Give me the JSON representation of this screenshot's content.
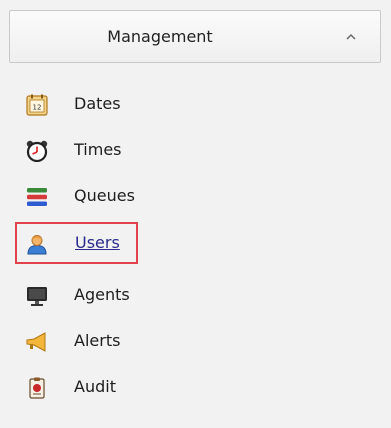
{
  "header": {
    "title": "Management"
  },
  "menu": {
    "items": [
      {
        "label": "Dates",
        "icon": "calendar-icon"
      },
      {
        "label": "Times",
        "icon": "alarm-clock-icon"
      },
      {
        "label": "Queues",
        "icon": "queues-icon"
      },
      {
        "label": "Users",
        "icon": "user-icon",
        "selected": true
      },
      {
        "label": "Agents",
        "icon": "monitor-icon"
      },
      {
        "label": "Alerts",
        "icon": "megaphone-icon"
      },
      {
        "label": "Audit",
        "icon": "audit-icon"
      }
    ],
    "calendar_day": "12"
  },
  "colors": {
    "selection_border": "#e3434a",
    "link_text": "#2a2a8c",
    "panel_bg": "#f2f2f2"
  }
}
